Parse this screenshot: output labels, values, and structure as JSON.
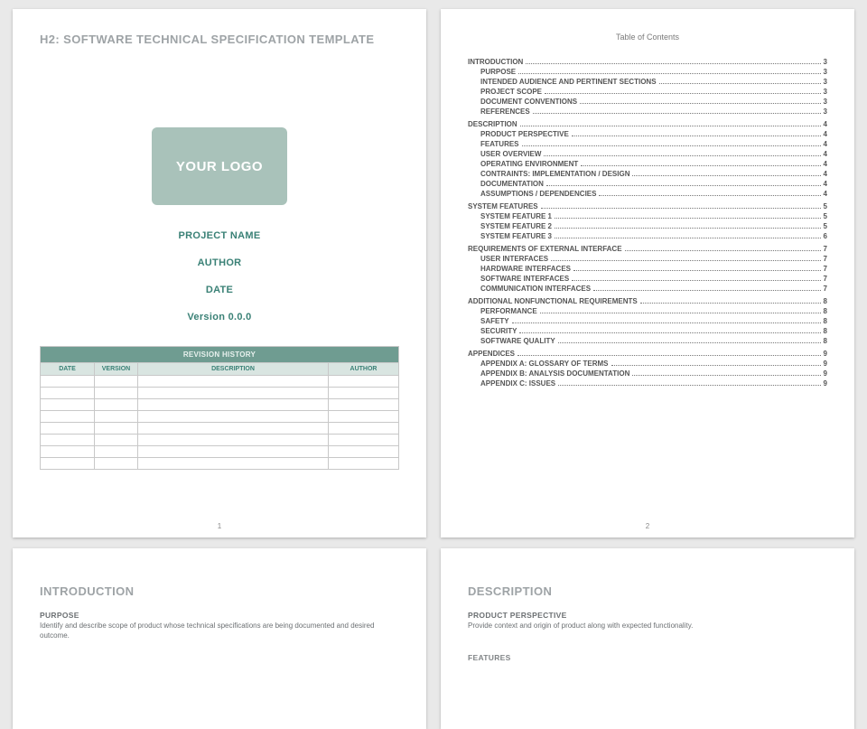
{
  "page1": {
    "doc_title": "H2: SOFTWARE TECHNICAL SPECIFICATION TEMPLATE",
    "logo_label": "YOUR LOGO",
    "project_name": "PROJECT NAME",
    "author": "AUTHOR",
    "date": "DATE",
    "version": "Version 0.0.0",
    "rev_title": "REVISION HISTORY",
    "rev_cols": {
      "date": "DATE",
      "version": "VERSION",
      "desc": "DESCRIPTION",
      "author": "AUTHOR"
    },
    "page_number": "1"
  },
  "page2": {
    "toc_title": "Table of Contents",
    "page_number": "2",
    "toc": [
      {
        "lvl": 1,
        "label": "INTRODUCTION",
        "pg": "3"
      },
      {
        "lvl": 2,
        "label": "PURPOSE",
        "pg": "3"
      },
      {
        "lvl": 2,
        "label": "INTENDED AUDIENCE AND PERTINENT SECTIONS",
        "pg": "3"
      },
      {
        "lvl": 2,
        "label": "PROJECT SCOPE",
        "pg": "3"
      },
      {
        "lvl": 2,
        "label": "DOCUMENT CONVENTIONS",
        "pg": "3"
      },
      {
        "lvl": 2,
        "label": "REFERENCES",
        "pg": "3"
      },
      {
        "lvl": 1,
        "label": "DESCRIPTION",
        "pg": "4"
      },
      {
        "lvl": 2,
        "label": "PRODUCT PERSPECTIVE",
        "pg": "4"
      },
      {
        "lvl": 2,
        "label": "FEATURES",
        "pg": "4"
      },
      {
        "lvl": 2,
        "label": "USER OVERVIEW",
        "pg": "4"
      },
      {
        "lvl": 2,
        "label": "OPERATING ENVIRONMENT",
        "pg": "4"
      },
      {
        "lvl": 2,
        "label": "CONTRAINTS: IMPLEMENTATION / DESIGN",
        "pg": "4"
      },
      {
        "lvl": 2,
        "label": "DOCUMENTATION",
        "pg": "4"
      },
      {
        "lvl": 2,
        "label": "ASSUMPTIONS / DEPENDENCIES",
        "pg": "4"
      },
      {
        "lvl": 1,
        "label": "SYSTEM FEATURES",
        "pg": "5"
      },
      {
        "lvl": 2,
        "label": "SYSTEM FEATURE 1",
        "pg": "5"
      },
      {
        "lvl": 2,
        "label": "SYSTEM FEATURE 2",
        "pg": "5"
      },
      {
        "lvl": 2,
        "label": "SYSTEM FEATURE 3",
        "pg": "6"
      },
      {
        "lvl": 1,
        "label": "REQUIREMENTS OF EXTERNAL INTERFACE",
        "pg": "7"
      },
      {
        "lvl": 2,
        "label": "USER INTERFACES",
        "pg": "7"
      },
      {
        "lvl": 2,
        "label": "HARDWARE INTERFACES",
        "pg": "7"
      },
      {
        "lvl": 2,
        "label": "SOFTWARE INTERFACES",
        "pg": "7"
      },
      {
        "lvl": 2,
        "label": "COMMUNICATION INTERFACES",
        "pg": "7"
      },
      {
        "lvl": 1,
        "label": "ADDITIONAL NONFUNCTIONAL REQUIREMENTS",
        "pg": "8"
      },
      {
        "lvl": 2,
        "label": "PERFORMANCE",
        "pg": "8"
      },
      {
        "lvl": 2,
        "label": "SAFETY",
        "pg": "8"
      },
      {
        "lvl": 2,
        "label": "SECURITY",
        "pg": "8"
      },
      {
        "lvl": 2,
        "label": "SOFTWARE QUALITY",
        "pg": "8"
      },
      {
        "lvl": 1,
        "label": "APPENDICES",
        "pg": "9"
      },
      {
        "lvl": 2,
        "label": "APPENDIX A:  GLOSSARY OF TERMS",
        "pg": "9"
      },
      {
        "lvl": 2,
        "label": "APPENDIX B:  ANALYSIS DOCUMENTATION",
        "pg": "9"
      },
      {
        "lvl": 2,
        "label": "APPENDIX C:  ISSUES",
        "pg": "9"
      }
    ]
  },
  "page3": {
    "heading": "INTRODUCTION",
    "sub1": "PURPOSE",
    "body1": "Identify and describe scope of product whose technical specifications are being documented and desired outcome."
  },
  "page4": {
    "heading": "DESCRIPTION",
    "sub1": "PRODUCT PERSPECTIVE",
    "body1": "Provide context and origin of product along with expected functionality.",
    "sub2": "FEATURES"
  }
}
